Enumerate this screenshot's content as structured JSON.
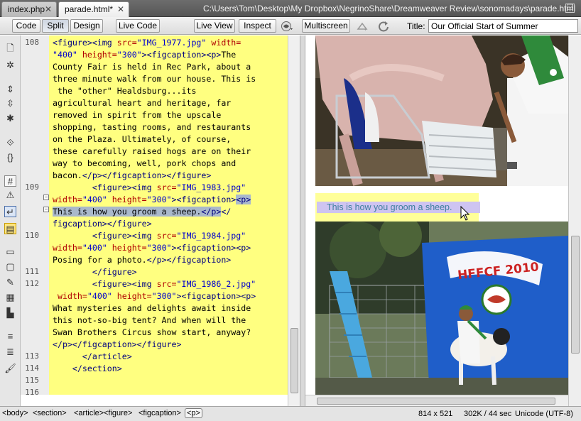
{
  "tabs": [
    {
      "label": "index.php",
      "close": "✕"
    },
    {
      "label": "parade.html*",
      "close": "✕"
    }
  ],
  "document_path": "C:\\Users\\Tom\\Desktop\\My Dropbox\\NegrinoShare\\Dreamweaver Review\\sonomadays\\parade.html",
  "toolbar": {
    "code": "Code",
    "split": "Split",
    "design": "Design",
    "live_code": "Live Code",
    "live_view": "Live View",
    "inspect": "Inspect",
    "multiscreen": "Multiscreen",
    "title_label": "Title:",
    "title_value": "Our Official Start of Summer"
  },
  "line_numbers": [
    {
      "n": "108",
      "row": 0
    },
    {
      "n": "109",
      "row": 12
    },
    {
      "n": "110",
      "row": 16
    },
    {
      "n": "111",
      "row": 19
    },
    {
      "n": "112",
      "row": 20
    },
    {
      "n": "113",
      "row": 26
    },
    {
      "n": "114",
      "row": 27
    },
    {
      "n": "115",
      "row": 28
    },
    {
      "n": "116",
      "row": 29
    }
  ],
  "code_lines": [
    [
      {
        "t": "<figure>",
        "c": "tg"
      },
      {
        "t": "<img ",
        "c": "tg"
      },
      {
        "t": "src=",
        "c": "at"
      },
      {
        "t": "\"IMG_1977.jpg\"",
        "c": "av"
      },
      {
        "t": " width=",
        "c": "at"
      }
    ],
    [
      {
        "t": "\"400\"",
        "c": "av"
      },
      {
        "t": " height=",
        "c": "at"
      },
      {
        "t": "\"300\"",
        "c": "av"
      },
      {
        "t": "><figcaption><p>",
        "c": "tg"
      },
      {
        "t": "The",
        "c": ""
      }
    ],
    [
      {
        "t": "County Fair is held in Rec Park, about a",
        "c": ""
      }
    ],
    [
      {
        "t": "three minute walk from our house. This is",
        "c": ""
      }
    ],
    [
      {
        "t": " the \"other\" Healdsburg...its",
        "c": ""
      }
    ],
    [
      {
        "t": "agricultural heart and heritage, far",
        "c": ""
      }
    ],
    [
      {
        "t": "removed in spirit from the upscale",
        "c": ""
      }
    ],
    [
      {
        "t": "shopping, tasting rooms, and restaurants",
        "c": ""
      }
    ],
    [
      {
        "t": "on the Plaza. Ultimately, of course,",
        "c": ""
      }
    ],
    [
      {
        "t": "these carefully raised hogs are on their",
        "c": ""
      }
    ],
    [
      {
        "t": "way to becoming, well, pork chops and",
        "c": ""
      }
    ],
    [
      {
        "t": "bacon.",
        "c": ""
      },
      {
        "t": "</p></figcaption></figure>",
        "c": "tg"
      }
    ],
    [
      {
        "t": "        ",
        "c": ""
      },
      {
        "t": "<figure>",
        "c": "tg"
      },
      {
        "t": "<img ",
        "c": "tg"
      },
      {
        "t": "src=",
        "c": "at"
      },
      {
        "t": "\"IMG_1983.jpg\"",
        "c": "av"
      }
    ],
    [
      {
        "t": "width=",
        "c": "at"
      },
      {
        "t": "\"400\"",
        "c": "av"
      },
      {
        "t": " height=",
        "c": "at"
      },
      {
        "t": "\"300\"",
        "c": "av"
      },
      {
        "t": "><figcaption>",
        "c": "tg"
      },
      {
        "t": "<p>",
        "c": "tg hl"
      }
    ],
    [
      {
        "t": "This is how you groom a sheep.",
        "c": "hl"
      },
      {
        "t": "</p>",
        "c": "tg hl"
      },
      {
        "t": "</",
        "c": "tg"
      }
    ],
    [
      {
        "t": "figcaption></figure>",
        "c": "tg"
      }
    ],
    [
      {
        "t": "        ",
        "c": ""
      },
      {
        "t": "<figure>",
        "c": "tg"
      },
      {
        "t": "<img ",
        "c": "tg"
      },
      {
        "t": "src=",
        "c": "at"
      },
      {
        "t": "\"IMG_1984.jpg\"",
        "c": "av"
      }
    ],
    [
      {
        "t": "width=",
        "c": "at"
      },
      {
        "t": "\"400\"",
        "c": "av"
      },
      {
        "t": " height=",
        "c": "at"
      },
      {
        "t": "\"300\"",
        "c": "av"
      },
      {
        "t": "><figcaption><p>",
        "c": "tg"
      }
    ],
    [
      {
        "t": "Posing for a photo.",
        "c": ""
      },
      {
        "t": "</p></figcaption>",
        "c": "tg"
      }
    ],
    [
      {
        "t": "        ",
        "c": ""
      },
      {
        "t": "</figure>",
        "c": "tg"
      }
    ],
    [
      {
        "t": "        ",
        "c": ""
      },
      {
        "t": "<figure>",
        "c": "tg"
      },
      {
        "t": "<img ",
        "c": "tg"
      },
      {
        "t": "src=",
        "c": "at"
      },
      {
        "t": "\"IMG_1986_2.jpg\"",
        "c": "av"
      }
    ],
    [
      {
        "t": " width=",
        "c": "at"
      },
      {
        "t": "\"400\"",
        "c": "av"
      },
      {
        "t": " height=",
        "c": "at"
      },
      {
        "t": "\"300\"",
        "c": "av"
      },
      {
        "t": "><figcaption><p>",
        "c": "tg"
      }
    ],
    [
      {
        "t": "What mysteries and delights await inside",
        "c": ""
      }
    ],
    [
      {
        "t": "this not-so-big tent? And when will the",
        "c": ""
      }
    ],
    [
      {
        "t": "Swan Brothers Circus show start, anyway?",
        "c": ""
      }
    ],
    [
      {
        "t": "</p></figcaption></figure>",
        "c": "tg"
      }
    ],
    [
      {
        "t": "      ",
        "c": ""
      },
      {
        "t": "</article>",
        "c": "tg"
      }
    ],
    [
      {
        "t": "    ",
        "c": ""
      },
      {
        "t": "</section>",
        "c": "tg"
      }
    ],
    [],
    []
  ],
  "design_caption": "This is how you groom a sheep.",
  "banner_text": "HFFCF 2010",
  "status": {
    "tags": [
      "<body>",
      "<section>",
      "<article>",
      "<figure>",
      "<figcaption>",
      "<p>"
    ],
    "window_size": "814 x 521",
    "file_size": "302K / 44 sec",
    "encoding": "Unicode (UTF-8)"
  },
  "colors": {
    "code_bg": "#ffff80",
    "selection": "#a9b8cb",
    "caption_highlight": "#cec4f1",
    "caption_text": "#3d7f9e"
  }
}
